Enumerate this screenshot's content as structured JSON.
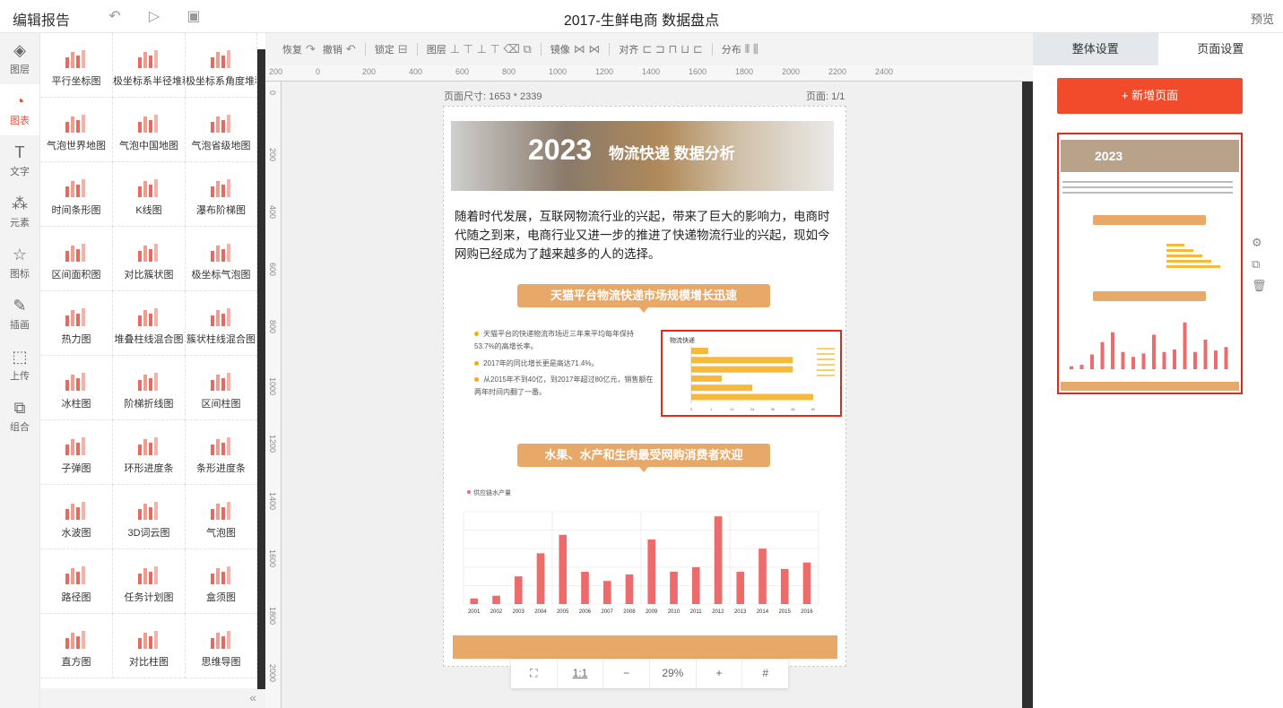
{
  "topbar": {
    "title": "编辑报告",
    "doc_title": "2017-生鲜电商 数据盘点",
    "preview": "预览",
    "icons": [
      "undo-icon",
      "play-icon",
      "save-icon"
    ]
  },
  "iconbar": [
    {
      "label": "图层",
      "icon": "layers-icon",
      "glyph": "◈"
    },
    {
      "label": "图表",
      "icon": "chart-icon",
      "glyph": "◔",
      "active": true
    },
    {
      "label": "文字",
      "icon": "text-icon",
      "glyph": "T"
    },
    {
      "label": "元素",
      "icon": "elements-icon",
      "glyph": "⁂"
    },
    {
      "label": "图标",
      "icon": "star-icon",
      "glyph": "☆"
    },
    {
      "label": "插画",
      "icon": "palette-icon",
      "glyph": "✎"
    },
    {
      "label": "上传",
      "icon": "upload-icon",
      "glyph": "⬚"
    },
    {
      "label": "组合",
      "icon": "combine-icon",
      "glyph": "⧉"
    }
  ],
  "chart_library": [
    "平行坐标图",
    "极坐标系半径堆积",
    "极坐标系角度堆积",
    "气泡世界地图",
    "气泡中国地图",
    "气泡省级地图",
    "时间条形图",
    "K线图",
    "瀑布阶梯图",
    "区间面积图",
    "对比簇状图",
    "极坐标气泡图",
    "热力图",
    "堆叠柱线混合图",
    "簇状柱线混合图",
    "冰柱图",
    "阶梯折线图",
    "区间柱图",
    "子弹图",
    "环形进度条",
    "条形进度条",
    "水波图",
    "3D词云图",
    "气泡图",
    "路径图",
    "任务计划图",
    "盒须图",
    "直方图",
    "对比柱图",
    "思维导图"
  ],
  "toolbar": {
    "items": [
      {
        "label": "恢复",
        "icon": "redo-icon",
        "glyph": "↷"
      },
      {
        "label": "撤销",
        "icon": "undo-icon",
        "glyph": "↶"
      },
      {
        "label": "锁定",
        "icon": "lock-icon",
        "glyph": "⊟"
      },
      {
        "label": "图层",
        "icon": "layer-order-icon",
        "glyph": "⊥ ⊤ ⊥ ⊤ ⌫ ⧉"
      },
      {
        "label": "镜像",
        "icon": "mirror-icon",
        "glyph": "⋈ ⋈"
      },
      {
        "label": "对齐",
        "icon": "align-icon",
        "glyph": "⊏ ⊐ ⊓ ⊔ ⊏"
      },
      {
        "label": "分布",
        "icon": "distribute-icon",
        "glyph": "⫴ ⫼"
      }
    ]
  },
  "ruler": {
    "h_labels": [
      "200",
      "0",
      "200",
      "400",
      "600",
      "800",
      "1000",
      "1200",
      "1400",
      "1600",
      "1800",
      "2000",
      "2200",
      "2400"
    ],
    "v_labels": [
      "0",
      "200",
      "400",
      "600",
      "800",
      "1000",
      "1200",
      "1400",
      "1600",
      "1800",
      "2000"
    ]
  },
  "canvas": {
    "page_size": "页面尺寸: 1653 * 2339",
    "page_num": "页面: 1/1"
  },
  "page": {
    "banner_year": "2023",
    "banner_title": "物流快递 数据分析",
    "intro": "随着时代发展，互联网物流行业的兴起，带来了巨大的影响力，电商时代随之到来，电商行业又进一步的推进了快递物流行业的兴起，现如今网购已经成为了越来越多的人的选择。",
    "section1_title": "天猫平台物流快递市场规模增长迅速",
    "bullets": [
      "天猫平台的快递物流市场近三年来平均每年保持53.7%的高增长率。",
      "2017年的同比增长更是高达71.4%。",
      "从2015年不到40亿，到2017年超过80亿元，销售额在两年时间内翻了一番。"
    ],
    "small_chart_title": "物流快递",
    "section2_title": "水果、水产和生肉最受网购消费者欢迎",
    "bar_legend": "供应链水产量",
    "accent": "#e8a968",
    "bar_color": "#ee6b6b"
  },
  "chart_data": [
    {
      "type": "bar",
      "orientation": "horizontal",
      "title": "物流快递",
      "categories": [
        "",
        "",
        "",
        "",
        "",
        ""
      ],
      "values": [
        10,
        60,
        60,
        18,
        36,
        72
      ],
      "xlim": [
        0,
        72
      ],
      "x_ticks": [
        "0",
        "1",
        "12",
        "24",
        "36",
        "48",
        "60"
      ],
      "color": "#f6b93b",
      "legend": "right"
    },
    {
      "type": "bar",
      "title": "",
      "series": [
        {
          "name": "供应链水产量",
          "values": [
            6,
            9,
            30,
            55,
            75,
            35,
            25,
            32,
            70,
            35,
            40,
            95,
            35,
            60,
            38,
            45
          ]
        }
      ],
      "categories": [
        "2001",
        "2002",
        "2003",
        "2004",
        "2005",
        "2006",
        "2007",
        "2008",
        "2009",
        "2010",
        "2011",
        "2012",
        "2013",
        "2014",
        "2015",
        "2016"
      ],
      "ylim": [
        0,
        100
      ],
      "grid": true,
      "color": "#ee6b6b",
      "legend": "top-left"
    }
  ],
  "zoom": {
    "fit_label": "⛶",
    "ratio_label": "1:1",
    "minus": "−",
    "value": "29%",
    "plus": "+",
    "grid_label": "#"
  },
  "rpanel": {
    "tabs": [
      "整体设置",
      "页面设置"
    ],
    "add_page": "+ 新增页面",
    "side_icons": [
      "gear-icon",
      "copy-icon",
      "trash-icon"
    ]
  }
}
